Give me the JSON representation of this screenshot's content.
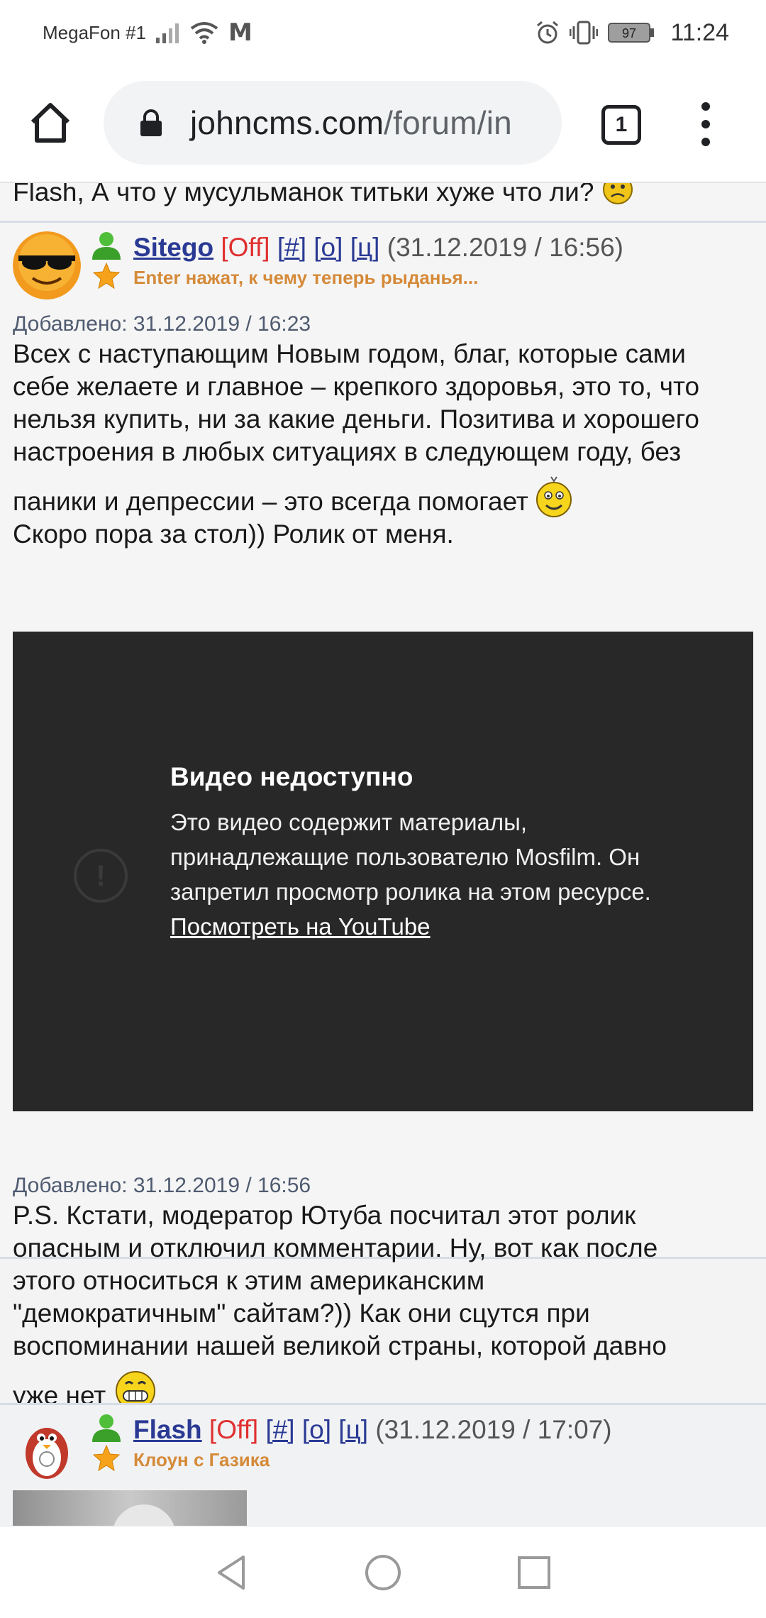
{
  "status_bar": {
    "carrier": "MegaFon #1",
    "network_letter": "M",
    "battery": "97",
    "time": "11:24"
  },
  "browser": {
    "url_domain": "johncms.com",
    "url_path": "/forum/in",
    "tab_count": "1"
  },
  "prev_post": {
    "text": "Flash, А что у мусульманок титьки хуже что ли?"
  },
  "post1": {
    "username": "Sitego",
    "status_tag": "[Off]",
    "link_hash": "[#]",
    "link_o": "[о]",
    "link_ts": "[ц]",
    "date": "(31.12.2019 / 16:56)",
    "user_status": "Enter нажат, к чему теперь рыданья...",
    "added1": "Добавлено: 31.12.2019 / 16:23",
    "body_line1": "Всех с наступающим Новым годом, благ, которые сами",
    "body_line2": "себе желаете и главное – крепкого здоровья, это то, что",
    "body_line3": "нельзя купить, ни за какие деньги. Позитива и хорошего",
    "body_line4": "настроения в любых ситуациях в следующем году, без",
    "body_line5": "паники и депрессии – это всегда помогает",
    "body_line6": "Скоро пора за стол)) Ролик от меня.",
    "video": {
      "title": "Видео недоступно",
      "message": "Это видео содержит материалы, принадлежащие пользователю Mosfilm. Он запретил просмотр ролика на этом ресурсе.",
      "link": "Посмотреть на YouTube"
    },
    "added2": "Добавлено: 31.12.2019 / 16:56",
    "ps_line1": "P.S. Кстати, модератор Ютуба посчитал этот ролик",
    "ps_line2": "опасным и отключил комментарии. Ну, вот как после",
    "ps_line3": "этого относиться к этим американским",
    "ps_line4": "\"демократичным\" сайтам?)) Как они сцутся при",
    "ps_line5": "воспоминании нашей великой страны, которой давно",
    "ps_line6": "уже нет"
  },
  "post2": {
    "username": "Flash",
    "status_tag": "[Off]",
    "link_hash": "[#]",
    "link_o": "[о]",
    "link_ts": "[ц]",
    "date": "(31.12.2019 / 17:07)",
    "user_status": "Клоун с Газика"
  },
  "colors": {
    "username": "#2a3a94",
    "offline": "#e03030",
    "user_status": "#d58a39",
    "video_bg": "#282828"
  }
}
